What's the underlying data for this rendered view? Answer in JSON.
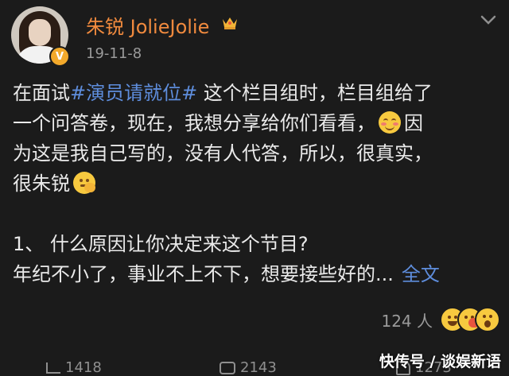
{
  "post": {
    "username": "朱锐 JolieJolie",
    "timestamp": "19-11-8",
    "verified_badge": "V",
    "content": {
      "line1_prefix": "在面试",
      "topic": "#演员请就位#",
      "line1_suffix": " 这个栏目组时，栏目组给了",
      "line2": "一个问答卷，现在，我想分享给你们看看，",
      "line2_end": "因",
      "line3": "为这是我自己写的，没有人代答，所以，很真实，",
      "line4": "很朱锐",
      "q1": "1、 什么原因让你决定来这个节目?",
      "answer_preview": "年纪不小了，事业不上不下，想要接些好的",
      "ellipsis": "...",
      "full_text_link": "全文"
    },
    "likes_text": "124 人",
    "reaction_icons": [
      "grinning-icon",
      "kiss-icon",
      "surprised-icon"
    ],
    "bottom_bar": {
      "share_count": "1418",
      "comment_count": "2143",
      "like_count": "1273"
    }
  },
  "watermark": "快传号 / 谈娱新语",
  "colors": {
    "background": "#1b1b1b",
    "username": "#f08a3e",
    "topic": "#5e8ddc",
    "text": "#eaeaea",
    "muted": "#9a9a9a"
  }
}
